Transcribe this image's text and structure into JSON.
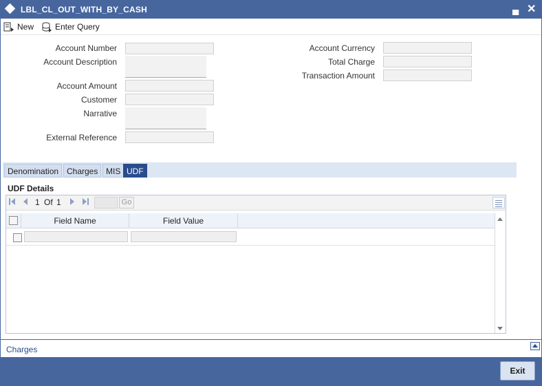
{
  "window": {
    "title": "LBL_CL_OUT_WITH_BY_CASH",
    "minimize_label": "▄",
    "close_label": "✕"
  },
  "toolbar": {
    "new_label": "New",
    "enter_query_label": "Enter Query"
  },
  "form_left": {
    "account_number_label": "Account Number",
    "account_description_label": "Account Description",
    "account_amount_label": "Account Amount",
    "customer_label": "Customer",
    "narrative_label": "Narrative",
    "external_reference_label": "External Reference"
  },
  "form_right": {
    "account_currency_label": "Account Currency",
    "total_charge_label": "Total Charge",
    "transaction_amount_label": "Transaction Amount"
  },
  "tabs": [
    {
      "label": "Denomination",
      "active": false
    },
    {
      "label": "Charges",
      "active": false
    },
    {
      "label": "MIS",
      "active": false
    },
    {
      "label": "UDF",
      "active": true
    }
  ],
  "udf": {
    "section_title": "UDF Details",
    "pager": {
      "current": "1",
      "of_label": "Of",
      "total": "1",
      "go_label": "Go"
    },
    "columns": [
      "Field Name",
      "Field Value"
    ]
  },
  "bottom": {
    "charges_link": "Charges"
  },
  "footer": {
    "exit_label": "Exit"
  },
  "colors": {
    "title_bar": "#47669e",
    "active_tab": "#2a4c8c",
    "tab_strip": "#dde7f3"
  }
}
